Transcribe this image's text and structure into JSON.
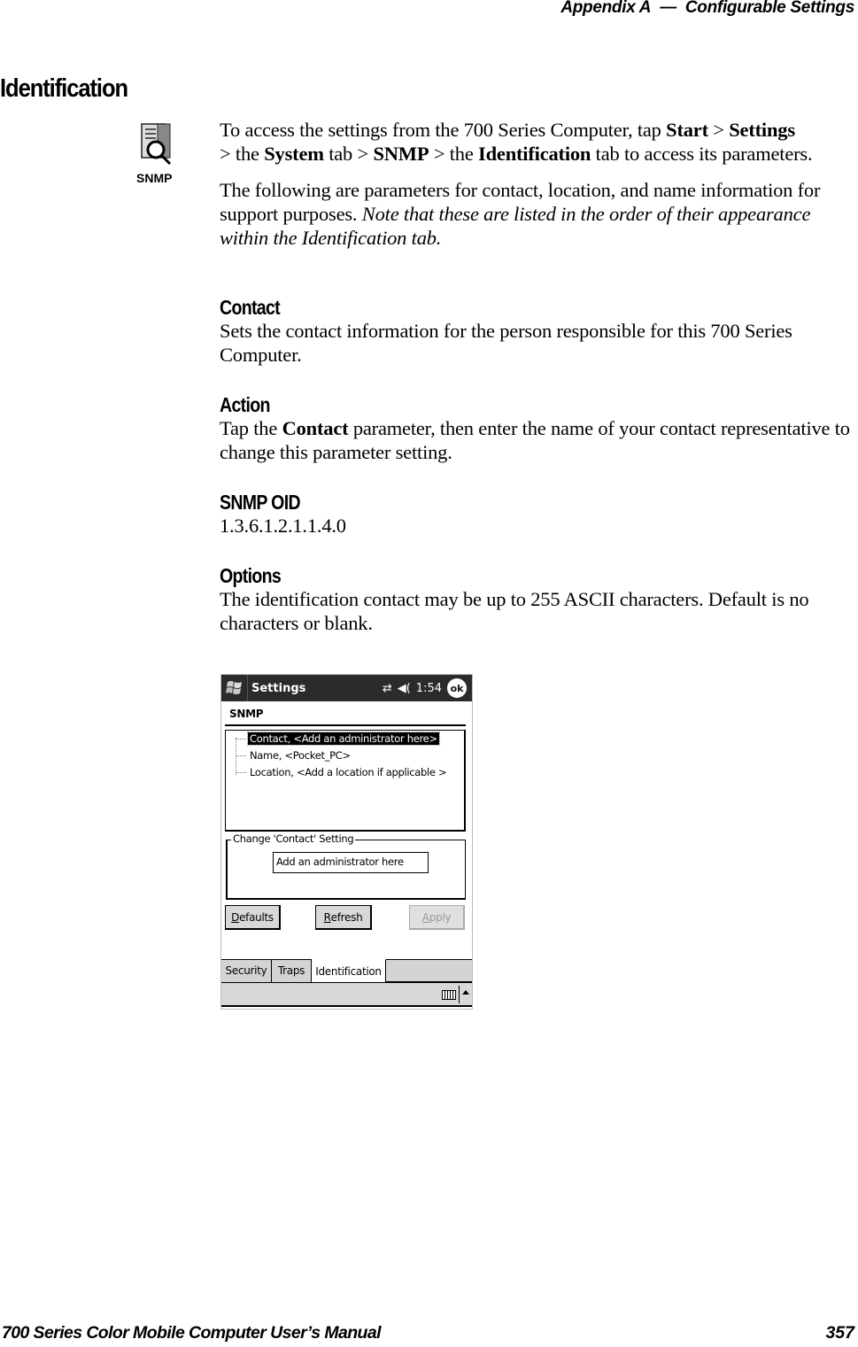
{
  "header": {
    "appendix": "Appendix A",
    "separator": "—",
    "chapter": "Configurable Settings"
  },
  "section": {
    "title": "Identification",
    "icon_name": "snmp-icon",
    "icon_label": "SNMP"
  },
  "intro": {
    "access_parts": [
      "To access the settings from the 700 Series Computer, tap ",
      "Start",
      " > ",
      "Settings",
      " > the ",
      "System",
      " tab > ",
      "SNMP",
      " > the ",
      "Identification",
      " tab to access its parameters."
    ],
    "desc_plain": "The following are parameters for contact, location, and name information for support purposes. ",
    "desc_italic": "Note that these are listed in the order of their appearance within the Identification tab."
  },
  "contact": {
    "heading": "Contact",
    "text": "Sets the contact information for the person responsible for this 700 Series Computer."
  },
  "action": {
    "heading": "Action",
    "text_before": "Tap the ",
    "text_bold": "Contact",
    "text_after": " parameter, then enter the name of your contact representative to change this parameter setting."
  },
  "oid": {
    "heading": "SNMP OID",
    "value": "1.3.6.1.2.1.1.4.0"
  },
  "options": {
    "heading": "Options",
    "text": "The identification contact may be up to 255 ASCII characters. Default is no characters or blank."
  },
  "screenshot": {
    "titlebar": {
      "title": "Settings",
      "time": "1:54",
      "ok_label": "ok",
      "icons": [
        "start-flag-icon",
        "connectivity-icon",
        "volume-icon"
      ]
    },
    "page_heading": "SNMP",
    "tree_items": [
      {
        "label": "Contact,  <Add an administrator here>",
        "selected": true
      },
      {
        "label": "Name,  <Pocket_PC>",
        "selected": false
      },
      {
        "label": "Location,  <Add a location if applicable >",
        "selected": false
      }
    ],
    "group_label": "Change 'Contact' Setting",
    "input_value": "Add an administrator here",
    "buttons": [
      {
        "accel": "D",
        "rest": "efaults",
        "enabled": true
      },
      {
        "accel": "R",
        "rest": "efresh",
        "enabled": true
      },
      {
        "accel": "A",
        "rest": "pply",
        "enabled": false
      }
    ],
    "tabs": [
      {
        "label": "Security",
        "active": false
      },
      {
        "label": "Traps",
        "active": false
      },
      {
        "label": "Identification",
        "active": true
      }
    ],
    "menubar_icons": [
      "keyboard-icon",
      "sip-arrow-icon"
    ]
  },
  "footer": {
    "manual_title": "700 Series Color Mobile Computer User’s Manual",
    "page_number": "357"
  }
}
